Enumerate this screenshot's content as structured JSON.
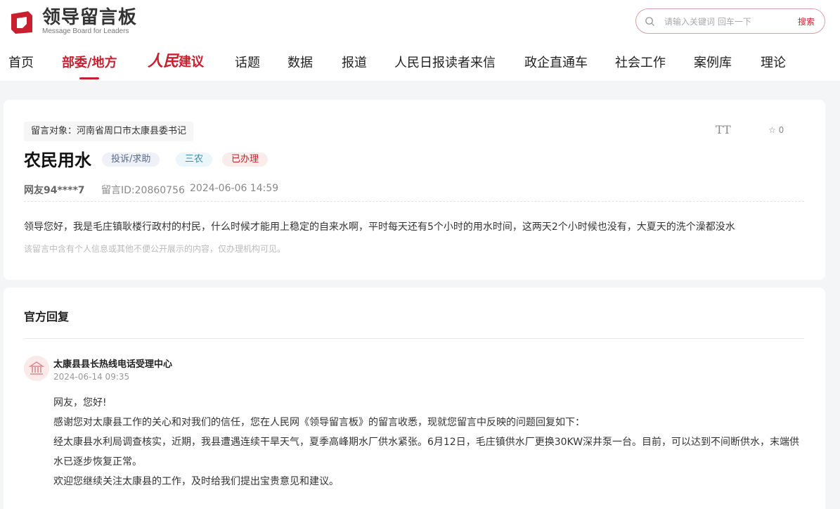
{
  "header": {
    "logo_title": "领导留言板",
    "logo_subtitle": "Message Board for Leaders",
    "search_placeholder": "请输入关键词 回车一下",
    "search_button": "搜索"
  },
  "nav": {
    "items": [
      "首页",
      "部委/地方",
      "人民建议",
      "话题",
      "数据",
      "报道",
      "人民日报读者来信",
      "政企直通车",
      "社会工作",
      "案例库",
      "理论"
    ],
    "rmjy_brush": "人民",
    "rmjy_text": "建议",
    "active_index": 1
  },
  "message": {
    "target": "留言对象：河南省周口市太康县委书记",
    "font_toggle": "TT",
    "favorite_count": "0",
    "title": "农民用水",
    "tags": [
      "投诉/求助",
      "三农",
      "已办理"
    ],
    "user": "网友94****7",
    "message_id": "留言ID:20860756",
    "time": "2024-06-06 14:59",
    "content": "领导您好，我是毛庄镇耿楼行政村的村民，什么时候才能用上稳定的自来水啊，平时每天还有5个小时的用水时间，这两天2个小时候也没有，大夏天的洗个澡都没水",
    "privacy_note": "该留言中含有个人信息或其他不便公开展示的内容，仅办理机构可见。"
  },
  "reply": {
    "heading": "官方回复",
    "org_name": "太康县县长热线电话受理中心",
    "time": "2024-06-14 09:35",
    "paragraphs": [
      "网友，您好!",
      "感谢您对太康县工作的关心和对我们的信任，您在人民网《领导留言板》的留言收悉，现就您留言中反映的问题回复如下：",
      "经太康县水利局调查核实，近期，我县遭遇连续干旱天气，夏季高峰期水厂供水紧张。6月12日，毛庄镇供水厂更换30KW深井泵一台。目前，可以达到不间断供水，末端供水已逐步恢复正常。",
      "欢迎您继续关注太康县的工作，及时给我们提出宝贵意见和建议。"
    ]
  },
  "colors": {
    "brand_red": "#c8202f",
    "page_bg": "#f4f5f7"
  }
}
